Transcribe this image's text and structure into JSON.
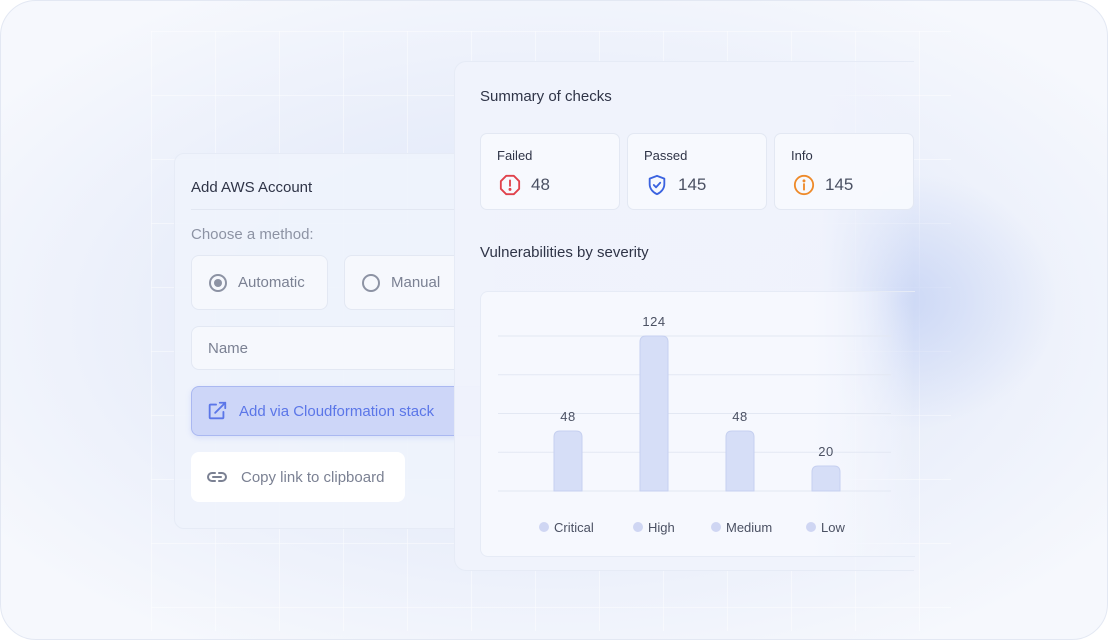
{
  "aws": {
    "title": "Add AWS Account",
    "method_label": "Choose a method:",
    "options": [
      "Automatic",
      "Manual"
    ],
    "selected_option": "Automatic",
    "name_placeholder": "Name",
    "cloudformation_label": "Add via Cloudformation stack",
    "copy_link_label": "Copy link to clipboard"
  },
  "summary": {
    "title": "Summary of checks",
    "stats": [
      {
        "label": "Failed",
        "value": "48",
        "icon": "alert-octagon-icon",
        "color": "#e0414b"
      },
      {
        "label": "Passed",
        "value": "145",
        "icon": "shield-check-icon",
        "color": "#3b63e0"
      },
      {
        "label": "Info",
        "value": "145",
        "icon": "info-circle-icon",
        "color": "#ee8a2a"
      }
    ]
  },
  "vulnerabilities": {
    "title": "Vulnerabilities by severity"
  },
  "chart_data": {
    "type": "bar",
    "categories": [
      "Critical",
      "High",
      "Medium",
      "Low"
    ],
    "values": [
      48,
      124,
      48,
      20
    ],
    "ylim": [
      0,
      124
    ],
    "grid": true,
    "legend_placement": "bottom",
    "bar_color": "#d6def7",
    "legend_dot_color": "#cfd6f3"
  },
  "colors": {
    "accent": "#5b76e8",
    "accent_bg": "#cdd6f8"
  }
}
